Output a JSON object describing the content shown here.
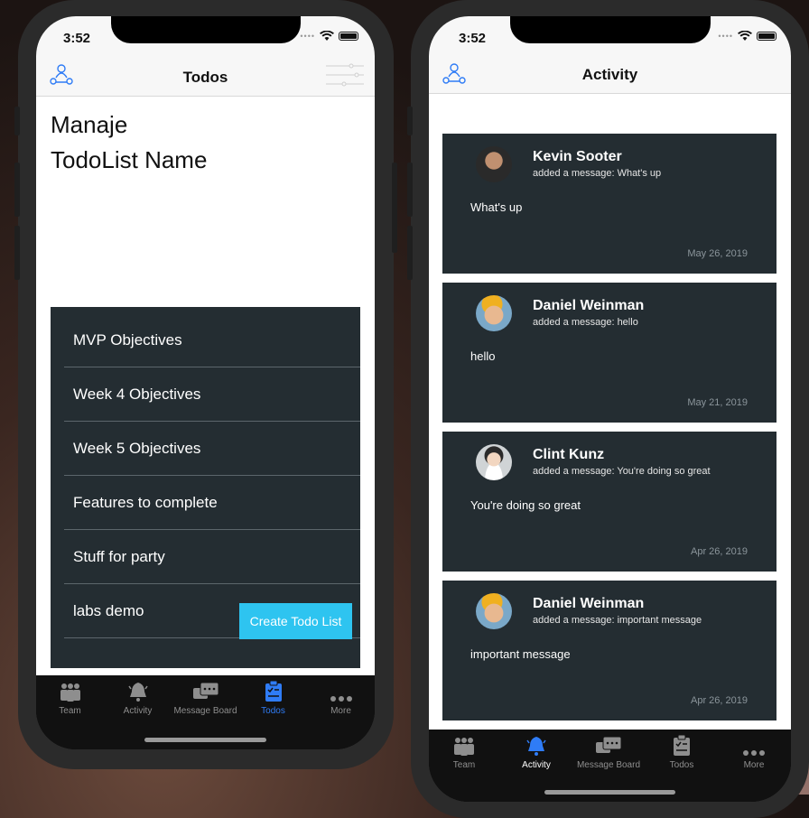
{
  "left_phone": {
    "status_time": "3:52",
    "nav_title": "Todos",
    "list_heading_line1": "Manaje",
    "list_heading_line2": "TodoList Name",
    "todo_lists": [
      "MVP Objectives",
      "Week 4 Objectives",
      "Week 5 Objectives",
      "Features to complete",
      "Stuff for party",
      "labs demo"
    ],
    "create_button": "Create Todo List",
    "tabs": [
      {
        "label": "Team",
        "icon": "team-icon"
      },
      {
        "label": "Activity",
        "icon": "bell-icon"
      },
      {
        "label": "Message Board",
        "icon": "message-board-icon"
      },
      {
        "label": "Todos",
        "icon": "todos-icon"
      },
      {
        "label": "More",
        "icon": "more-icon"
      }
    ],
    "active_tab": "Todos"
  },
  "right_phone": {
    "status_time": "3:52",
    "nav_title": "Activity",
    "activities": [
      {
        "name": "Kevin Sooter",
        "action": "added a message: What's up",
        "body": "What's up",
        "date": "May 26, 2019",
        "avatar": "kevin-avatar"
      },
      {
        "name": "Daniel Weinman",
        "action": "added a message: hello",
        "body": "hello",
        "date": "May 21, 2019",
        "avatar": "daniel-avatar"
      },
      {
        "name": "Clint Kunz",
        "action": "added a message: You're doing so great",
        "body": "You're doing so great",
        "date": "Apr 26, 2019",
        "avatar": "default-avatar"
      },
      {
        "name": "Daniel Weinman",
        "action": "added a message: important message",
        "body": "important message",
        "date": "Apr 26, 2019",
        "avatar": "daniel-avatar"
      }
    ],
    "tabs": [
      {
        "label": "Team",
        "icon": "team-icon"
      },
      {
        "label": "Activity",
        "icon": "bell-icon"
      },
      {
        "label": "Message Board",
        "icon": "message-board-icon"
      },
      {
        "label": "Todos",
        "icon": "todos-icon"
      },
      {
        "label": "More",
        "icon": "more-icon"
      }
    ],
    "active_tab": "Activity"
  },
  "colors": {
    "card_bg": "#242d32",
    "accent_blue": "#2f7cf6",
    "create_button": "#2ec4f0",
    "tab_inactive": "#8e8e8e"
  }
}
